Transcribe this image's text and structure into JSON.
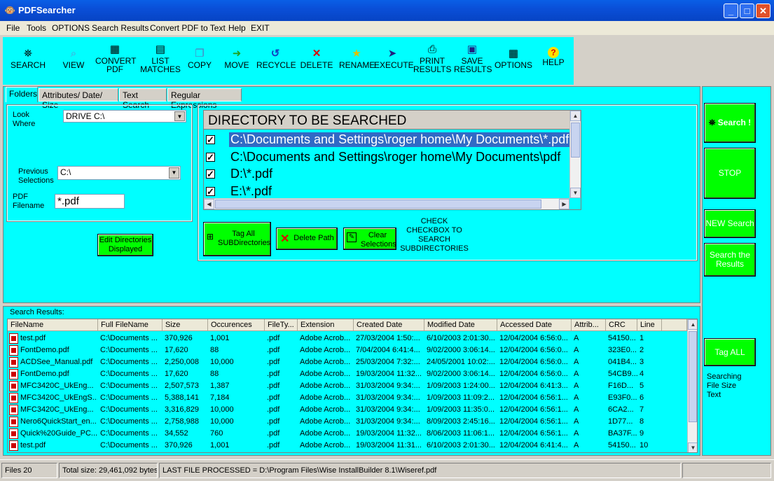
{
  "window": {
    "title": "PDFSearcher",
    "min": "_",
    "max": "□",
    "close": "✕"
  },
  "menu": [
    "File",
    "Tools",
    "OPTIONS",
    "Search Results",
    "Convert PDF to Text",
    "Help",
    "EXIT"
  ],
  "toolbar": [
    {
      "l1": "SEARCH",
      "l2": "",
      "icon": "binoculars-icon",
      "glyph": "⛯"
    },
    {
      "l1": "VIEW",
      "l2": "",
      "icon": "magnifier-icon",
      "glyph": "🔍"
    },
    {
      "l1": "CONVERT",
      "l2": "PDF",
      "icon": "convert-icon",
      "glyph": "▦"
    },
    {
      "l1": "LIST",
      "l2": "MATCHES",
      "icon": "list-icon",
      "glyph": "▤"
    },
    {
      "l1": "COPY",
      "l2": "",
      "icon": "copy-icon",
      "glyph": "❐"
    },
    {
      "l1": "MOVE",
      "l2": "",
      "icon": "move-icon",
      "glyph": "➜"
    },
    {
      "l1": "RECYCLE",
      "l2": "",
      "icon": "recycle-icon",
      "glyph": "↺"
    },
    {
      "l1": "DELETE",
      "l2": "",
      "icon": "delete-icon",
      "glyph": "✕"
    },
    {
      "l1": "RENAME",
      "l2": "",
      "icon": "star-icon",
      "glyph": "★"
    },
    {
      "l1": "EXECUTE",
      "l2": "",
      "icon": "execute-icon",
      "glyph": "➤"
    },
    {
      "l1": "PRINT",
      "l2": "RESULTS",
      "icon": "printer-icon",
      "glyph": "⎙"
    },
    {
      "l1": "SAVE",
      "l2": "RESULTS",
      "icon": "floppy-icon",
      "glyph": "💾"
    },
    {
      "l1": "OPTIONS",
      "l2": "",
      "icon": "options-icon",
      "glyph": "▣"
    },
    {
      "l1": "HELP",
      "l2": "",
      "icon": "help-icon",
      "glyph": "?"
    }
  ],
  "tabs": [
    "Folders",
    "Attributes/ Date/ Size",
    "Text Search",
    "Regular Expressions"
  ],
  "folders": {
    "look_where_label": "Look Where",
    "look_where_value": "DRIVE C:\\",
    "previous_label": "Previous Selections",
    "previous_value": "C:\\",
    "pdf_filename_label": "PDF Filename",
    "pdf_filename_value": "*.pdf",
    "edit_dirs_button": "Edit Directories Displayed"
  },
  "directory": {
    "header": "DIRECTORY TO BE SEARCHED",
    "rows": [
      {
        "path": "C:\\Documents and Settings\\roger home\\My Documents\\*.pdf",
        "checked": "✓",
        "selected": true
      },
      {
        "path": "C:\\Documents and Settings\\roger home\\My Documents\\pdf",
        "checked": "✓",
        "selected": false
      },
      {
        "path": "D:\\*.pdf",
        "checked": "✓",
        "selected": false
      },
      {
        "path": "E:\\*.pdf",
        "checked": "✓",
        "selected": false
      }
    ],
    "tag_all_button": "Tag All SUBDirectories",
    "delete_path_button": "Delete Path",
    "clear_button": "Clear Selections",
    "check_note": "CHECK CHECKBOX TO SEARCH SUBDIRECTORIES"
  },
  "right_buttons": {
    "search": "Search !",
    "stop": "STOP",
    "new_search": "NEW Search",
    "search_results": "Search the Results",
    "tag_all": "Tag ALL",
    "status": "Searching File Size Text"
  },
  "results": {
    "label": "Search Results:",
    "columns": [
      "FileName",
      "Full FileName",
      "Size",
      "Occurences",
      "FileTy...",
      "Extension",
      "Created Date",
      "Modified Date",
      "Accessed Date",
      "Attrib...",
      "CRC",
      "Line"
    ],
    "rows": [
      [
        "test.pdf",
        "C:\\Documents ...",
        "370,926",
        "1,001",
        ".pdf",
        "Adobe Acrob...",
        "27/03/2004 1:50:...",
        "6/10/2003 2:01:30...",
        "12/04/2004 6:56:0...",
        "A",
        "54150...",
        "1"
      ],
      [
        "FontDemo.pdf",
        "C:\\Documents ...",
        "17,620",
        "88",
        ".pdf",
        "Adobe Acrob...",
        "7/04/2004 6:41:4...",
        "9/02/2000 3:06:14...",
        "12/04/2004 6:56:0...",
        "A",
        "323E0...",
        "2"
      ],
      [
        "ACDSee_Manual.pdf",
        "C:\\Documents ...",
        "2,250,008",
        "10,000",
        ".pdf",
        "Adobe Acrob...",
        "25/03/2004 7:32:...",
        "24/05/2001 10:02:...",
        "12/04/2004 6:56:0...",
        "A",
        "041B4...",
        "3"
      ],
      [
        "FontDemo.pdf",
        "C:\\Documents ...",
        "17,620",
        "88",
        ".pdf",
        "Adobe Acrob...",
        "19/03/2004 11:32...",
        "9/02/2000 3:06:14...",
        "12/04/2004 6:56:0...",
        "A",
        "54CB9...",
        "4"
      ],
      [
        "MFC3420C_UkEng...",
        "C:\\Documents ...",
        "2,507,573",
        "1,387",
        ".pdf",
        "Adobe Acrob...",
        "31/03/2004 9:34:...",
        "1/09/2003 1:24:00...",
        "12/04/2004 6:41:3...",
        "A",
        "F16D...",
        "5"
      ],
      [
        "MFC3420C_UkEngS...",
        "C:\\Documents ...",
        "5,388,141",
        "7,184",
        ".pdf",
        "Adobe Acrob...",
        "31/03/2004 9:34:...",
        "1/09/2003 11:09:2...",
        "12/04/2004 6:56:1...",
        "A",
        "E93F0...",
        "6"
      ],
      [
        "MFC3420C_UkEng...",
        "C:\\Documents ...",
        "3,316,829",
        "10,000",
        ".pdf",
        "Adobe Acrob...",
        "31/03/2004 9:34:...",
        "1/09/2003 11:35:0...",
        "12/04/2004 6:56:1...",
        "A",
        "6CA2...",
        "7"
      ],
      [
        "Nero6QuickStart_en...",
        "C:\\Documents ...",
        "2,758,988",
        "10,000",
        ".pdf",
        "Adobe Acrob...",
        "31/03/2004 9:34:...",
        "8/09/2003 2:45:16...",
        "12/04/2004 6:56:1...",
        "A",
        "1D77...",
        "8"
      ],
      [
        "Quick%20Guide_PC...",
        "C:\\Documents ...",
        "34,552",
        "760",
        ".pdf",
        "Adobe Acrob...",
        "19/03/2004 11:32...",
        "8/06/2003 11:06:1...",
        "12/04/2004 6:56:1...",
        "A",
        "BA37F...",
        "9"
      ],
      [
        "test.pdf",
        "C:\\Documents ...",
        "370,926",
        "1,001",
        ".pdf",
        "Adobe Acrob...",
        "19/03/2004 11:31...",
        "6/10/2003 2:01:30...",
        "12/04/2004 6:41:4...",
        "A",
        "54150...",
        "10"
      ]
    ]
  },
  "status": {
    "files": "Files 20",
    "total": "Total size: 29,461,092 bytes",
    "last": "LAST FILE PROCESSED  =  D:\\Program Files\\Wise InstallBuilder 8.1\\Wiseref.pdf"
  },
  "colors": {
    "panel": "#00ffff",
    "button": "#00ff00",
    "selection": "#316ac5"
  }
}
